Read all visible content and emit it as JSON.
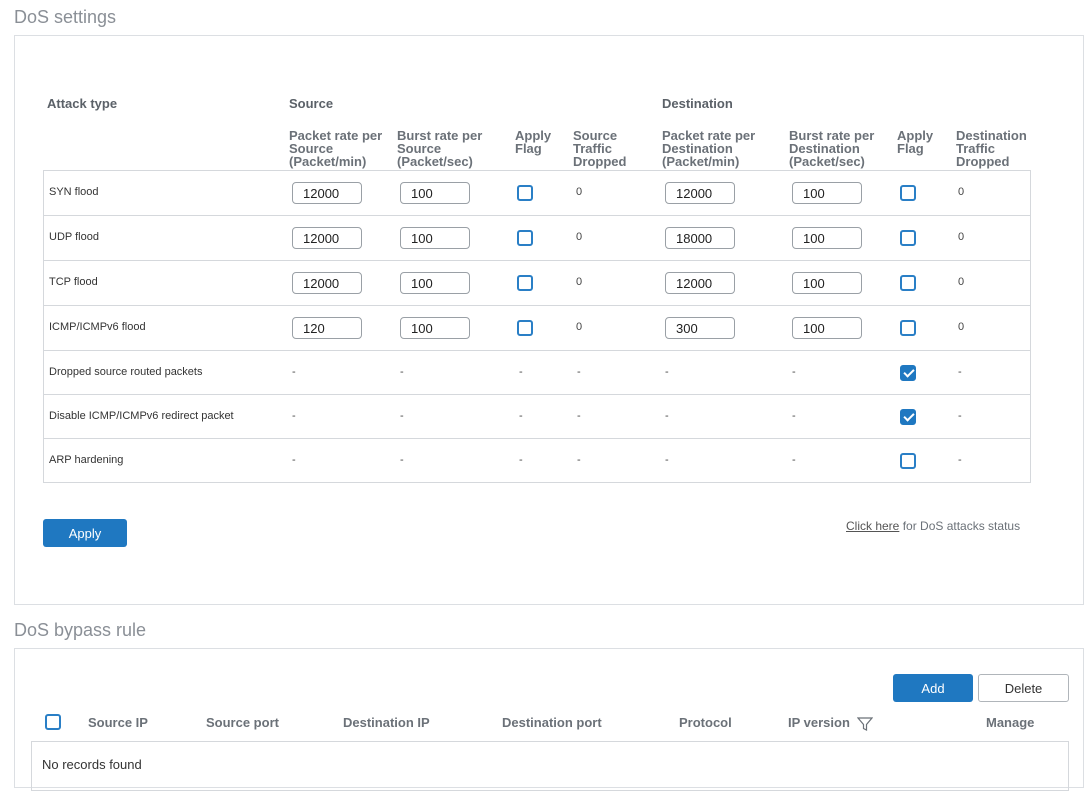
{
  "dos": {
    "title": "DoS settings",
    "headers": {
      "attack_type": "Attack type",
      "source": "Source",
      "destination": "Destination"
    },
    "columns": [
      [
        "Packet rate per",
        "Source",
        "(Packet/min)"
      ],
      [
        "Burst rate per",
        "Source",
        "(Packet/sec)"
      ],
      [
        "Apply",
        "Flag"
      ],
      [
        "Source",
        "Traffic",
        "Dropped"
      ],
      [
        "Packet rate per",
        "Destination",
        "(Packet/min)"
      ],
      [
        "Burst rate per",
        "Destination",
        "(Packet/sec)"
      ],
      [
        "Apply",
        "Flag"
      ],
      [
        "Destination",
        "Traffic",
        "Dropped"
      ]
    ],
    "rows": [
      {
        "name": "SYN flood",
        "src_packet_rate": "12000",
        "src_burst_rate": "100",
        "src_apply": false,
        "src_dropped": "0",
        "dst_packet_rate": "12000",
        "dst_burst_rate": "100",
        "dst_apply": false,
        "dst_dropped": "0"
      },
      {
        "name": "UDP flood",
        "src_packet_rate": "12000",
        "src_burst_rate": "100",
        "src_apply": false,
        "src_dropped": "0",
        "dst_packet_rate": "18000",
        "dst_burst_rate": "100",
        "dst_apply": false,
        "dst_dropped": "0"
      },
      {
        "name": "TCP flood",
        "src_packet_rate": "12000",
        "src_burst_rate": "100",
        "src_apply": false,
        "src_dropped": "0",
        "dst_packet_rate": "12000",
        "dst_burst_rate": "100",
        "dst_apply": false,
        "dst_dropped": "0"
      },
      {
        "name": "ICMP/ICMPv6 flood",
        "src_packet_rate": "120",
        "src_burst_rate": "100",
        "src_apply": false,
        "src_dropped": "0",
        "dst_packet_rate": "300",
        "dst_burst_rate": "100",
        "dst_apply": false,
        "dst_dropped": "0"
      }
    ],
    "flag_rows": [
      {
        "name": "Dropped source routed packets",
        "placeholder": "-",
        "checked": true
      },
      {
        "name": "Disable ICMP/ICMPv6 redirect packet",
        "placeholder": "-",
        "checked": true
      },
      {
        "name": "ARP hardening",
        "placeholder": "-",
        "checked": false
      }
    ],
    "apply_label": "Apply",
    "status_link": "Click here",
    "status_text": " for DoS attacks status"
  },
  "bypass": {
    "title": "DoS bypass rule",
    "add_label": "Add",
    "delete_label": "Delete",
    "columns": [
      "Source IP",
      "Source port",
      "Destination IP",
      "Destination port",
      "Protocol",
      "IP version",
      "Manage"
    ],
    "filter_icon": "filter-icon",
    "empty_text": "No records found"
  },
  "colors": {
    "accent": "#1f78c1",
    "border": "#d5d8dc",
    "title": "#8a8f96"
  }
}
